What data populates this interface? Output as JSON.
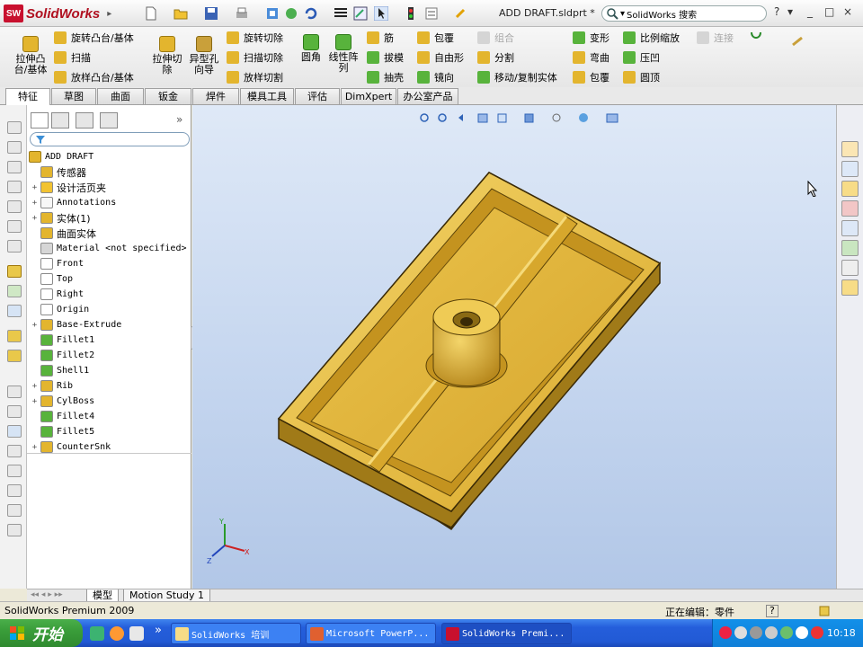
{
  "app": {
    "brand": "SolidWorks",
    "document_title": "ADD DRAFT.sldprt *",
    "search_placeholder": "SolidWorks 搜索",
    "help_btn": "?",
    "dropdown_btn": "▾",
    "minimize": "_",
    "maximize": "□",
    "close": "×"
  },
  "ribbon": {
    "boss_extrude": "拉伸凸台/基体",
    "revolve_boss": "旋转凸台/基体",
    "sweep": "扫描",
    "loft_boss": "放样凸台/基体",
    "extrude_cut": "拉伸切除",
    "hole_wizard": "异型孔向导",
    "revolve_cut": "旋转切除",
    "sweep_cut": "扫描切除",
    "loft_cut": "放样切割",
    "fillet": "圆角",
    "linear_pattern": "线性阵列",
    "rib": "筋",
    "draft": "拔模",
    "shell": "抽壳",
    "wrap": "包覆",
    "freeform": "自由形",
    "mirror": "镜向",
    "combine": "组合",
    "split": "分割",
    "move_copy": "移动/复制实体",
    "flex": "变形",
    "deform": "弯曲",
    "indent": "包覆",
    "scale": "比例缩放",
    "dome": "压凹",
    "dome2": "圆顶",
    "connect": "连接"
  },
  "tabs": [
    "特征",
    "草图",
    "曲面",
    "钣金",
    "焊件",
    "模具工具",
    "评估",
    "DimXpert",
    "办公室产品"
  ],
  "tree": {
    "root": "ADD DRAFT",
    "items": [
      {
        "label": "传感器",
        "expand": "",
        "cn": true
      },
      {
        "label": "设计活页夹",
        "expand": "+",
        "cn": true
      },
      {
        "label": "Annotations",
        "expand": "+",
        "cn": false
      },
      {
        "label": "实体(1)",
        "expand": "+",
        "cn": true
      },
      {
        "label": "曲面实体",
        "expand": "",
        "cn": true
      },
      {
        "label": "Material <not specified>",
        "expand": "",
        "cn": false
      },
      {
        "label": "Front",
        "expand": "",
        "cn": false
      },
      {
        "label": "Top",
        "expand": "",
        "cn": false
      },
      {
        "label": "Right",
        "expand": "",
        "cn": false
      },
      {
        "label": "Origin",
        "expand": "",
        "cn": false
      },
      {
        "label": "Base-Extrude",
        "expand": "+",
        "cn": false
      },
      {
        "label": "Fillet1",
        "expand": "",
        "cn": false
      },
      {
        "label": "Fillet2",
        "expand": "",
        "cn": false
      },
      {
        "label": "Shell1",
        "expand": "",
        "cn": false
      },
      {
        "label": "Rib",
        "expand": "+",
        "cn": false
      },
      {
        "label": "CylBoss",
        "expand": "+",
        "cn": false
      },
      {
        "label": "Fillet4",
        "expand": "",
        "cn": false
      },
      {
        "label": "Fillet5",
        "expand": "",
        "cn": false
      },
      {
        "label": "CounterSnk",
        "expand": "+",
        "cn": false
      }
    ]
  },
  "model_tabs": {
    "model": "模型",
    "motion": "Motion Study 1"
  },
  "status": {
    "product": "SolidWorks Premium 2009",
    "editing": "正在编辑：零件",
    "help": "?"
  },
  "triad": {
    "x": "X",
    "y": "Y",
    "z": "Z"
  },
  "taskbar": {
    "start": "开始",
    "overflow": "»",
    "tasks": [
      {
        "label": "SolidWorks 培训",
        "active": false
      },
      {
        "label": "Microsoft PowerP...",
        "active": false
      },
      {
        "label": "SolidWorks Premi...",
        "active": true
      }
    ],
    "clock": "10:18"
  },
  "colors": {
    "part_body": "#e0b23c",
    "part_shadow": "#8a6a14",
    "brand_red": "#c8102e",
    "xp_blue": "#245edb",
    "xp_green": "#3a9d3a"
  }
}
